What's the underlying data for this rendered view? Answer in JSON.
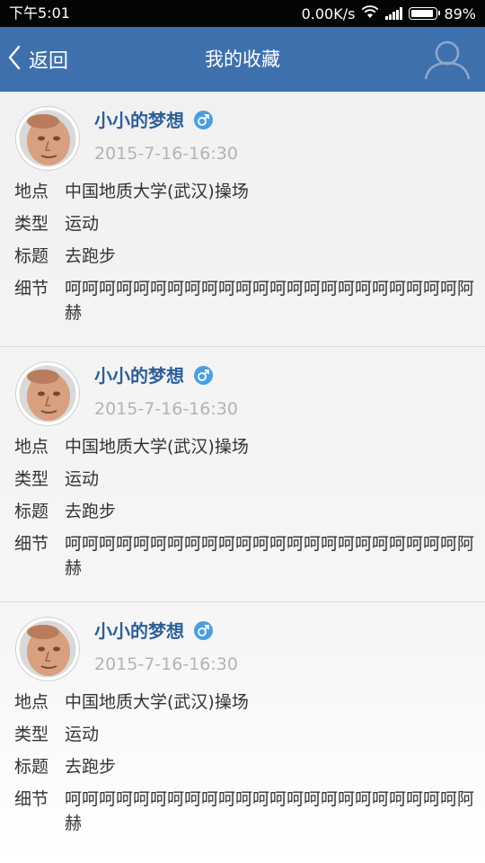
{
  "status_bar": {
    "time": "下午5:01",
    "network_speed": "0.00K/s",
    "battery": "89%",
    "icons": [
      "wifi-icon",
      "signal-icon",
      "battery-icon"
    ]
  },
  "nav": {
    "back_label": "返回",
    "title": "我的收藏",
    "icons": [
      "chevron-left-icon",
      "user-profile-icon"
    ],
    "background_color": "#3e70ad"
  },
  "labels": {
    "place": "地点",
    "type": "类型",
    "title": "标题",
    "detail": "细节"
  },
  "posts": [
    {
      "username": "小小的梦想",
      "gender_icon": "male-icon",
      "date": "2015-7-16-16:30",
      "place": "中国地质大学(武汉)操场",
      "type": "运动",
      "title": "去跑步",
      "detail": "呵呵呵呵呵呵呵呵呵呵呵呵呵呵呵呵呵呵呵呵呵呵呵阿赫"
    },
    {
      "username": "小小的梦想",
      "gender_icon": "male-icon",
      "date": "2015-7-16-16:30",
      "place": "中国地质大学(武汉)操场",
      "type": "运动",
      "title": "去跑步",
      "detail": "呵呵呵呵呵呵呵呵呵呵呵呵呵呵呵呵呵呵呵呵呵呵呵阿赫"
    },
    {
      "username": "小小的梦想",
      "gender_icon": "male-icon",
      "date": "2015-7-16-16:30",
      "place": "中国地质大学(武汉)操场",
      "type": "运动",
      "title": "去跑步",
      "detail": "呵呵呵呵呵呵呵呵呵呵呵呵呵呵呵呵呵呵呵呵呵呵呵阿赫"
    }
  ],
  "colors": {
    "username": "#2c5f98",
    "date": "#b3b3b3",
    "gender_badge": "#4b9fe0"
  }
}
